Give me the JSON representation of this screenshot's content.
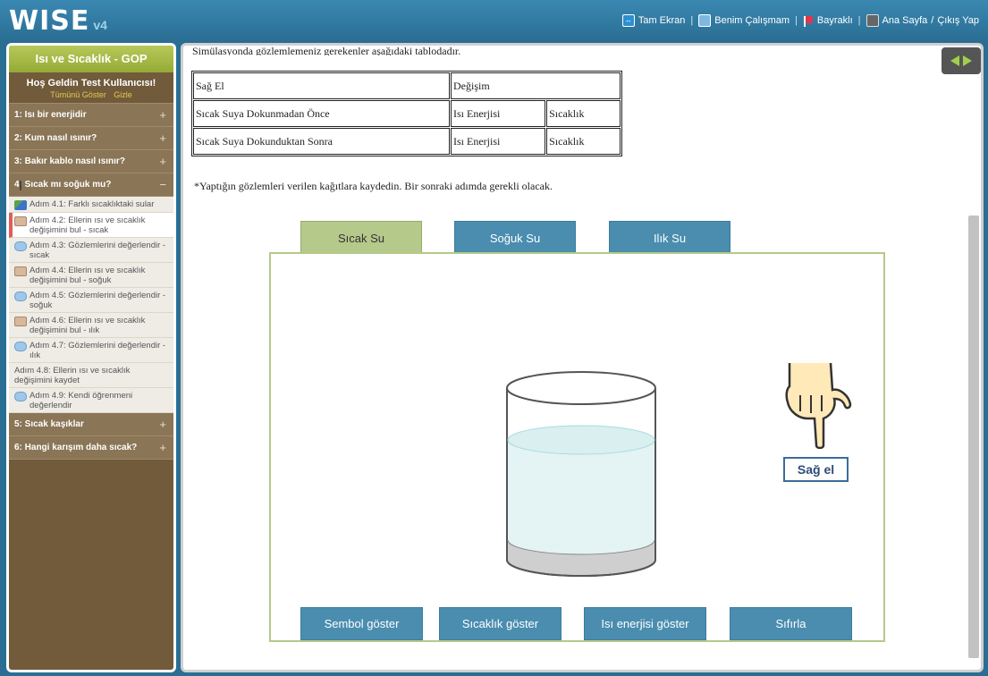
{
  "header": {
    "logo": "WISE",
    "version": "v4",
    "nav": {
      "fullscreen": "Tam Ekran",
      "mywork": "Benim Çalışmam",
      "flagged": "Bayraklı",
      "home": "Ana Sayfa",
      "slash": "/",
      "logout": "Çıkış Yap"
    }
  },
  "sidebar": {
    "title": "Isı ve Sıcaklık - GOP",
    "welcome": "Hoş Geldin Test Kullanıcısı!",
    "show_all": "Tümünü Göster",
    "hide": "Gizle",
    "activities": [
      {
        "label": "1: Isı bir enerjidir",
        "sign": "+"
      },
      {
        "label": "2: Kum nasıl ısınır?",
        "sign": "+"
      },
      {
        "label": "3: Bakır kablo nasıl ısınır?",
        "sign": "+"
      },
      {
        "label": "4: Sıcak mı soğuk mu?",
        "sign": "−"
      }
    ],
    "steps": [
      {
        "label": "Adım 4.1: Farklı sıcaklıktaki sular",
        "icon": "chart-icon"
      },
      {
        "label": "Adım 4.2: Ellerin ısı ve sıcaklık değişimini bul - sıcak",
        "icon": "person-icon"
      },
      {
        "label": "Adım 4.3: Gözlemlerini değerlendir - sıcak",
        "icon": "reflect-icon"
      },
      {
        "label": "Adım 4.4: Ellerin ısı ve sıcaklık değişimini bul - soğuk",
        "icon": "person-icon"
      },
      {
        "label": "Adım 4.5: Gözlemlerini değerlendir - soğuk",
        "icon": "reflect-icon"
      },
      {
        "label": "Adım 4.6: Ellerin ısı ve sıcaklık değişimini bul - ılık",
        "icon": "person-icon"
      },
      {
        "label": "Adım 4.7: Gözlemlerini değerlendir - ılık",
        "icon": "reflect-icon"
      },
      {
        "label": "Adım 4.8: Ellerin ısı ve sıcaklık değişimini kaydet",
        "icon": "note-icon"
      },
      {
        "label": "Adım 4.9: Kendi öğrenmeni değerlendir",
        "icon": "reflect-icon"
      }
    ],
    "activities_after": [
      {
        "label": "5: Sıcak kaşıklar",
        "sign": "+"
      },
      {
        "label": "6: Hangi karışım daha sıcak?",
        "sign": "+"
      }
    ]
  },
  "main": {
    "intro": "Simülasyonda gözlemlemeniz gerekenler aşağıdaki tablodadır.",
    "table": {
      "header": [
        "Sağ El",
        "Değişim"
      ],
      "rows": [
        [
          "Sıcak Suya Dokunmadan Önce",
          "Isı Enerjisi",
          "Sıcaklık"
        ],
        [
          "Sıcak Suya Dokunduktan Sonra",
          "Isı Enerjisi",
          "Sıcaklık"
        ]
      ]
    },
    "note": "*Yaptığın gözlemleri verilen kağıtlara kaydedin. Bir sonraki adımda gerekli olacak.",
    "tabs": [
      "Sıcak Su",
      "Soğuk Su",
      "Ilık Su"
    ],
    "hand_label": "Sağ el",
    "buttons": [
      "Sembol göster",
      "Sıcaklık göster",
      "Isı enerjisi göster",
      "Sıfırla"
    ]
  }
}
